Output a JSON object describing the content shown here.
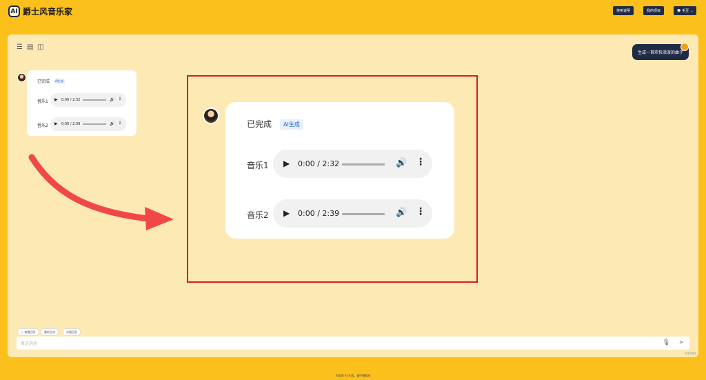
{
  "header": {
    "logo_badge": "AI",
    "title": "爵士风音乐家",
    "buttons": [
      "使用说明",
      "我的项目"
    ],
    "user_label": "毛豆"
  },
  "toolbar": {
    "icons": [
      "list-icon",
      "document-icon",
      "html-icon"
    ]
  },
  "user_message": "生成一首欢快活泼的曲子",
  "reply_small": {
    "status": "已完成",
    "tag": "AI生成",
    "tracks": [
      {
        "label": "音乐1",
        "time": "0:00 / 2:32"
      },
      {
        "label": "音乐2",
        "time": "0:00 / 2:39"
      }
    ]
  },
  "reply_large": {
    "status": "已完成",
    "tag": "AI生成",
    "tracks": [
      {
        "label": "音乐1",
        "time": "0:00 / 2:32"
      },
      {
        "label": "音乐2",
        "time": "0:00 / 2:39"
      }
    ]
  },
  "quick_actions": [
    "查看回答",
    "重新生成",
    "详细回答"
  ],
  "input": {
    "placeholder": "发送消息",
    "counter": "0/10000"
  },
  "footer": "内容由 AI 生成，请仔细甄别",
  "colors": {
    "background": "#fbc01c",
    "panel": "#fde9b4",
    "accent": "#1f2a44",
    "highlight": "#d71d1d"
  }
}
